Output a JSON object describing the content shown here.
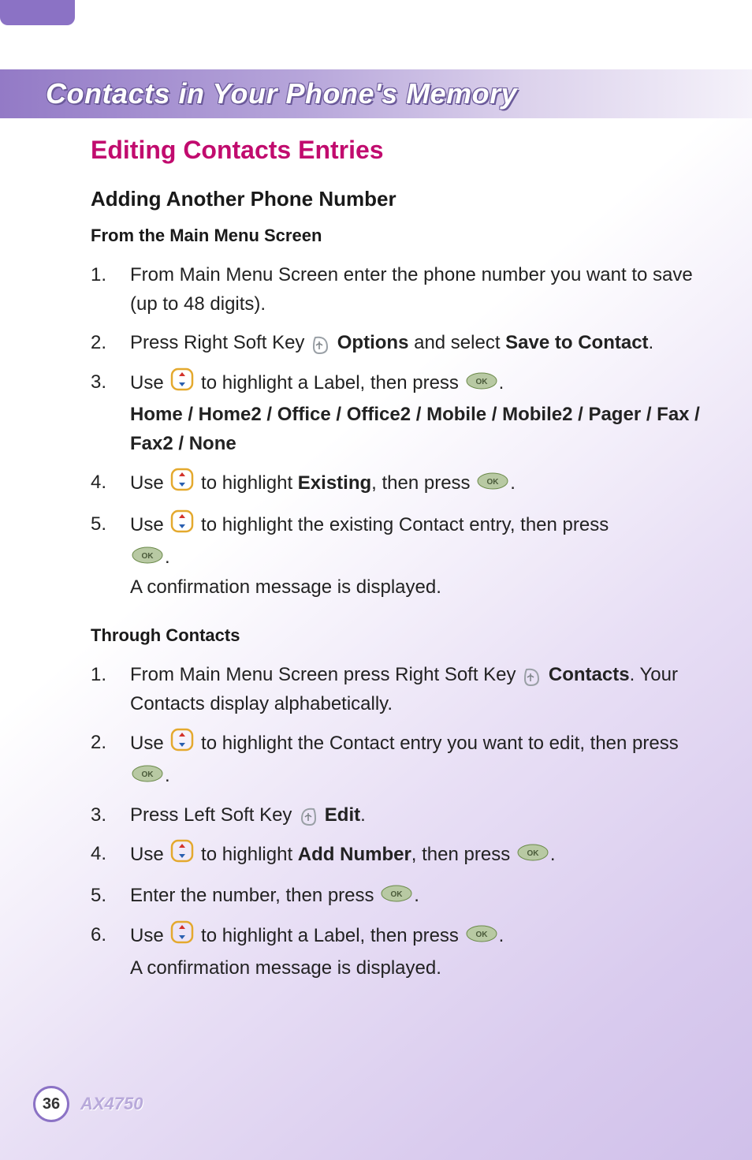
{
  "header": {
    "title": "Contacts in Your Phone's Memory"
  },
  "section_title": "Editing Contacts Entries",
  "sub1": "Adding Another Phone Number",
  "sub2": "From the Main Menu Screen",
  "list1": {
    "item1": {
      "num": "1.",
      "text": "From Main Menu Screen enter the phone number you want to save (up to 48 digits)."
    },
    "item2": {
      "num": "2.",
      "pre": "Press Right Soft Key ",
      "bold1": "Options",
      "mid": " and select ",
      "bold2": "Save to Contact",
      "post": "."
    },
    "item3": {
      "num": "3.",
      "pre": "Use ",
      "mid": " to highlight a Label, then press ",
      "post": ".",
      "labels_line": "Home / Home2 / Office / Office2 / Mobile / Mobile2 / Pager / Fax / Fax2 / None"
    },
    "item4": {
      "num": "4.",
      "pre": "Use ",
      "mid": " to highlight ",
      "bold": "Existing",
      "mid2": ", then press ",
      "post": "."
    },
    "item5": {
      "num": "5.",
      "pre": "Use ",
      "mid": " to highlight the existing Contact entry, then press ",
      "post": ".",
      "confirm": "A confirmation message is displayed."
    }
  },
  "sub3": "Through Contacts",
  "list2": {
    "item1": {
      "num": "1.",
      "pre": "From Main Menu Screen press Right Soft Key ",
      "bold": "Contacts",
      "post": ". Your Contacts display alphabetically."
    },
    "item2": {
      "num": "2.",
      "pre": "Use ",
      "mid": " to highlight the Contact entry you want to edit, then press ",
      "post": "."
    },
    "item3": {
      "num": "3.",
      "pre": "Press Left Soft Key ",
      "bold": "Edit",
      "post": "."
    },
    "item4": {
      "num": "4.",
      "pre": "Use ",
      "mid": " to highlight ",
      "bold": "Add Number",
      "mid2": ", then press ",
      "post": "."
    },
    "item5": {
      "num": "5.",
      "pre": "Enter the number, then press ",
      "post": "."
    },
    "item6": {
      "num": "6.",
      "pre": "Use ",
      "mid": " to highlight a Label, then press ",
      "post": ".",
      "confirm": "A confirmation message is displayed."
    }
  },
  "footer": {
    "page": "36",
    "model": "AX4750"
  }
}
